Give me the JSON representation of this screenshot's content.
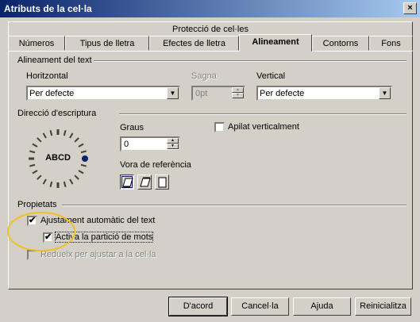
{
  "window": {
    "title": "Atributs de la cel·la",
    "close": "×"
  },
  "tabs_back": [
    {
      "label": "Protecció de cel·les"
    }
  ],
  "tabs": [
    {
      "label": "Números"
    },
    {
      "label": "Tipus de lletra"
    },
    {
      "label": "Efectes de lletra"
    },
    {
      "label": "Alineament",
      "active": true
    },
    {
      "label": "Contorns"
    },
    {
      "label": "Fons"
    }
  ],
  "alignment": {
    "group_title": "Alineament del text",
    "horizontal_label": "Horitzontal",
    "horizontal_value": "Per defecte",
    "indent_label": "Sagna",
    "indent_value": "0pt",
    "vertical_label": "Vertical",
    "vertical_value": "Per defecte"
  },
  "direction": {
    "group_title": "Direcció d'escriptura",
    "dial_text": "ABCD",
    "degrees_label": "Graus",
    "degrees_value": "0",
    "stacked_label": "Apilat verticalment",
    "stacked_checked": false,
    "ref_edge_label": "Vora de referència"
  },
  "properties": {
    "group_title": "Propietats",
    "auto_wrap_label": "Ajustament automàtic del text",
    "auto_wrap_checked": true,
    "hyphenation_label": "Activa la partició de mots",
    "hyphenation_checked": true,
    "shrink_label": "Redueix per ajustar a la cel·la",
    "shrink_checked": false
  },
  "buttons": {
    "ok": "D'acord",
    "cancel": "Cancel·la",
    "help": "Ajuda",
    "reset": "Reinicialitza"
  },
  "colors": {
    "highlight_circle": "#f0c020",
    "titlebar_start": "#0a246a",
    "dial_marker": "#0a246a"
  }
}
